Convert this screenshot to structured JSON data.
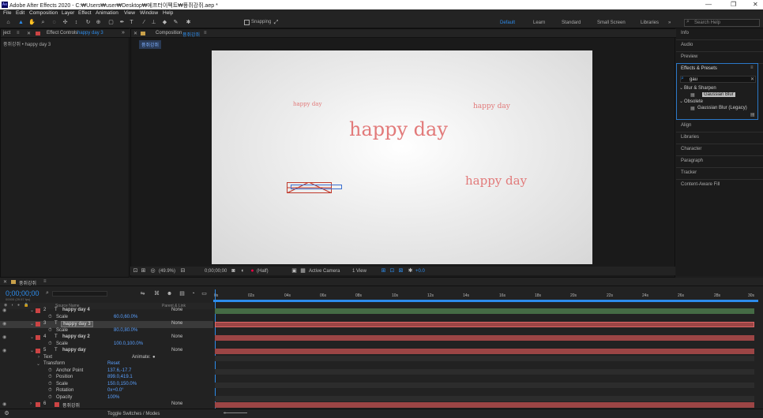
{
  "window": {
    "title": "Adobe After Effects 2020 - C:₩Users₩user₩Desktop₩에프터이펙트₩퓽쥐강쥐.aep *",
    "logo": "Ae"
  },
  "menu": [
    "File",
    "Edit",
    "Composition",
    "Layer",
    "Effect",
    "Animation",
    "View",
    "Window",
    "Help"
  ],
  "toolbar": {
    "snapping_label": "Snapping",
    "workspaces": [
      "Default",
      "Learn",
      "Standard",
      "Small Screen",
      "Libraries"
    ],
    "active_workspace": "Default",
    "search_placeholder": "Search Help"
  },
  "left_panel": {
    "tab_prefix": "ject",
    "tab_label": "Effect Controls",
    "tab_layer": "happy day 3",
    "breadcrumb": "퓽쥐강쥐 • happy day 3"
  },
  "comp_panel": {
    "tab_label": "Composition",
    "comp_name": "퓽쥐강쥐",
    "sub_tab": "퓽쥐강쥐",
    "texts": [
      "happy day",
      "happy day",
      "happy day",
      "happy day"
    ],
    "bottom": {
      "zoom": "(49.9%)",
      "timecode": "0;00;00;00",
      "resolution": "(Half)",
      "camera": "Active Camera",
      "views": "1 View",
      "exposure": "+0.0"
    }
  },
  "right_panel": {
    "items_top": [
      "Info",
      "Audio",
      "Preview"
    ],
    "effects_title": "Effects & Presets",
    "search_value": "gau",
    "groups": [
      {
        "name": "Blur & Sharpen",
        "items": [
          "Gaussian Blur"
        ]
      },
      {
        "name": "Obsolete",
        "items": [
          "Gaussian Blur (Legacy)"
        ]
      }
    ],
    "items_bottom": [
      "Align",
      "Libraries",
      "Character",
      "Paragraph",
      "Tracker",
      "Content-Aware Fill"
    ]
  },
  "timeline": {
    "tab_label": "퓽쥐강쥐",
    "timecode": "0;00;00;00",
    "fps": "00000 (29.97 fps)",
    "col_source": "Source Name",
    "col_parent": "Parent & Link",
    "ruler": [
      "0s",
      "02s",
      "04s",
      "06s",
      "08s",
      "10s",
      "12s",
      "14s",
      "16s",
      "18s",
      "20s",
      "22s",
      "24s",
      "26s",
      "28s",
      "30s"
    ],
    "rows": [
      {
        "num": "2",
        "type": "T",
        "name": "happy day 4",
        "parent": "None"
      },
      {
        "prop": "Scale",
        "value": "60.0,60.0%"
      },
      {
        "num": "3",
        "type": "T",
        "name": "happy day 3",
        "parent": "None",
        "selected": true
      },
      {
        "prop": "Scale",
        "value": "80.0,80.0%"
      },
      {
        "num": "4",
        "type": "T",
        "name": "happy day 2",
        "parent": "None"
      },
      {
        "prop": "Scale",
        "value": "100.0,100.0%"
      },
      {
        "num": "5",
        "type": "T",
        "name": "happy day",
        "parent": "None"
      },
      {
        "group": "Text",
        "animate": "Animate:"
      },
      {
        "group": "Transform",
        "reset": "Reset"
      },
      {
        "prop": "Anchor Point",
        "value": "137.6,-17.7"
      },
      {
        "prop": "Position",
        "value": "899.0,419.1"
      },
      {
        "prop": "Scale",
        "value": "150.0,150.0%"
      },
      {
        "prop": "Rotation",
        "value": "0x+0.0°"
      },
      {
        "prop": "Opacity",
        "value": "100%"
      },
      {
        "num": "6",
        "type": "comp",
        "name": "퓽쥐강쥐",
        "parent": "None"
      }
    ],
    "toggle_label": "Toggle Switches / Modes"
  },
  "colors": {
    "accent": "#2d8ceb",
    "label_red": "#c44444",
    "bar_red": "#9c4545",
    "text_pink": "#e27a7a"
  }
}
